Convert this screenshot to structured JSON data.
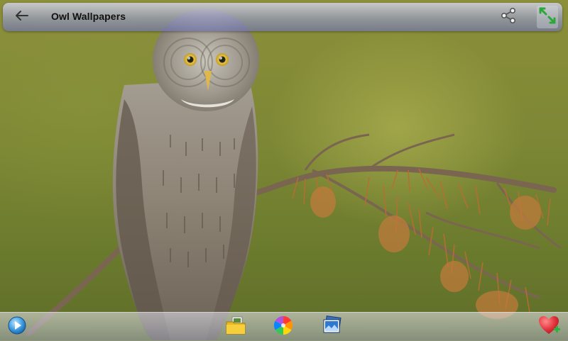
{
  "header": {
    "title": "Owl Wallpapers",
    "back_icon": "arrow-left-icon",
    "share_icon": "share-icon",
    "zoom_icon": "fullscreen-arrows-icon"
  },
  "wallpaper": {
    "subject": "owl-perched-on-branch"
  },
  "bottom_bar": {
    "items": [
      {
        "icon": "play-slideshow-icon"
      },
      {
        "icon": "folder-icon"
      },
      {
        "icon": "color-wheel-icon"
      },
      {
        "icon": "gallery-icon"
      },
      {
        "icon": "favorite-add-icon"
      }
    ]
  },
  "colors": {
    "header_bg": "#9a9fcc",
    "favorite": "#e0303a",
    "zoom_arrows": "#2aa83a"
  }
}
